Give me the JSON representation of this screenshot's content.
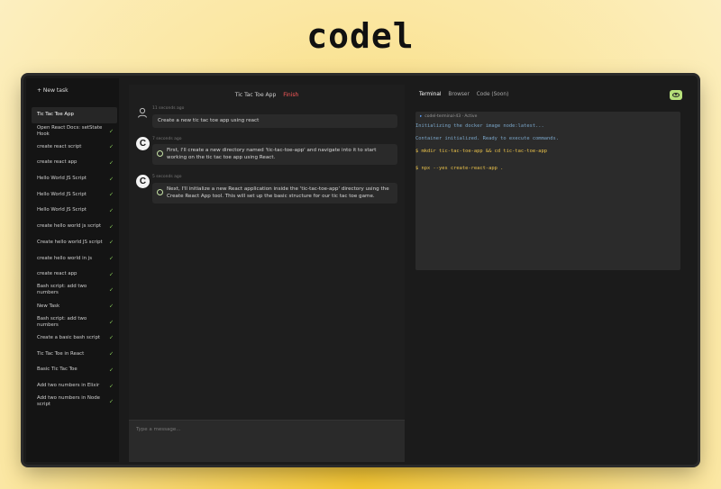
{
  "brand": {
    "logo": "codel"
  },
  "sidebar": {
    "new_task": "+ New task",
    "tasks": [
      {
        "label": "Tic Tac Toe App",
        "active": true,
        "check": ""
      },
      {
        "label": "Open React Docs: setState Hook",
        "check": "✓"
      },
      {
        "label": "create react script",
        "check": "✓"
      },
      {
        "label": "create react app",
        "check": "✓"
      },
      {
        "label": "Hello World JS Script",
        "check": "✓"
      },
      {
        "label": "Hello World JS Script",
        "check": "✓"
      },
      {
        "label": "Hello World JS Script",
        "check": "✓"
      },
      {
        "label": "create hello world js script",
        "check": "✓"
      },
      {
        "label": "Create hello world JS script",
        "check": "✓"
      },
      {
        "label": "create hello world in js",
        "check": "✓"
      },
      {
        "label": "create react app",
        "check": "✓"
      },
      {
        "label": "Bash script: add two numbers",
        "check": "✓"
      },
      {
        "label": "New Task",
        "check": "✓"
      },
      {
        "label": "Bash script: add two numbers",
        "check": "✓"
      },
      {
        "label": "Create a basic bash script",
        "check": "✓"
      },
      {
        "label": "Tic Tac Toe in React",
        "check": "✓"
      },
      {
        "label": "Basic Tic Tac Toe",
        "check": "✓"
      },
      {
        "label": "Add two numbers in Elixir",
        "check": "✓"
      },
      {
        "label": "Add two numbers in Node script",
        "check": "✓"
      }
    ]
  },
  "chat": {
    "title": "Tic Tac Toe App",
    "status": "Finish",
    "messages": [
      {
        "timestamp": "11 seconds ago",
        "text": "Create a new tic tac toe app using react"
      },
      {
        "timestamp": "7 seconds ago",
        "text": "First, I'll create a new directory named 'tic-tac-toe-app' and navigate into it to start working on the tic tac toe app using React."
      },
      {
        "timestamp": "5 seconds ago",
        "text": "Next, I'll initialize a new React application inside the 'tic-tac-toe-app' directory using the Create React App tool. This will set up the basic structure for our tic tac toe game."
      }
    ],
    "input_placeholder": "Type a message..."
  },
  "right_panel": {
    "tabs": [
      "Terminal",
      "Browser",
      "Code (Soon)"
    ],
    "terminal": {
      "header": "codel-terminal-43 · Active",
      "lines": [
        {
          "type": "info",
          "text": "Initializing the docker image node:latest..."
        },
        {
          "type": "info",
          "text": "Container initialized. Ready to execute commands."
        },
        {
          "type": "cmd",
          "text": "$ mkdir tic-tac-toe-app && cd tic-tac-toe-app"
        },
        {
          "type": "cmd",
          "text": "$ npx --yes create-react-app ."
        }
      ]
    }
  },
  "colors": {
    "accent": "#b6e07a",
    "finish": "#ff5a5a",
    "check": "#8bd15b",
    "terminal_info": "#7aa5c8",
    "terminal_cmd": "#e8c04a"
  }
}
